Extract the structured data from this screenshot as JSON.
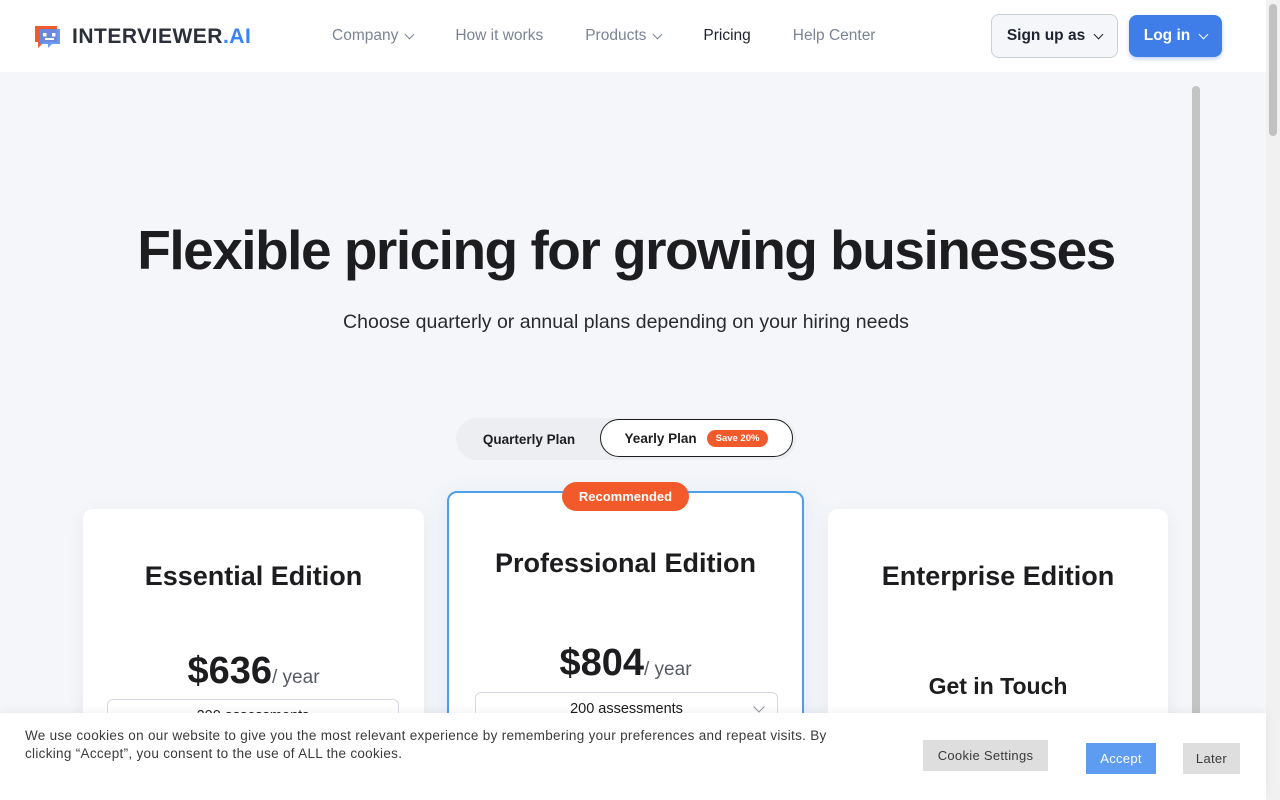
{
  "brand": {
    "name_main": "INTERVIEWER",
    "name_suffix": ".AI"
  },
  "nav": {
    "items": [
      {
        "label": "Company",
        "has_dropdown": true
      },
      {
        "label": "How it works",
        "has_dropdown": false
      },
      {
        "label": "Products",
        "has_dropdown": true
      },
      {
        "label": "Pricing",
        "has_dropdown": false,
        "active": true
      },
      {
        "label": "Help Center",
        "has_dropdown": false
      }
    ],
    "signup_label": "Sign up as",
    "login_label": "Log in"
  },
  "hero": {
    "title": "Flexible pricing for growing businesses",
    "subtitle": "Choose quarterly or annual plans depending on your hiring needs"
  },
  "plan_toggle": {
    "quarterly_label": "Quarterly Plan",
    "yearly_label": "Yearly Plan",
    "save_badge": "Save 20%",
    "selected": "Yearly Plan"
  },
  "plans": {
    "essential": {
      "title": "Essential Edition",
      "price": "$636",
      "period": "/ year",
      "assessments": "200 assessments"
    },
    "professional": {
      "badge": "Recommended",
      "title": "Professional Edition",
      "price": "$804",
      "period": "/ year",
      "assessments": "200 assessments"
    },
    "enterprise": {
      "title": "Enterprise Edition",
      "cta": "Get in Touch"
    }
  },
  "cookie": {
    "text": "We use cookies on our website to give you the most relevant experience by remembering your preferences and repeat visits. By clicking “Accept”, you consent to the use of ALL the cookies.",
    "settings_label": "Cookie Settings",
    "accept_label": "Accept",
    "later_label": "Later"
  },
  "colors": {
    "primary": "#3f7de8",
    "accent_orange": "#f25a2b",
    "card_border_recommended": "#4f9ee8",
    "background": "#f4f6f9"
  }
}
